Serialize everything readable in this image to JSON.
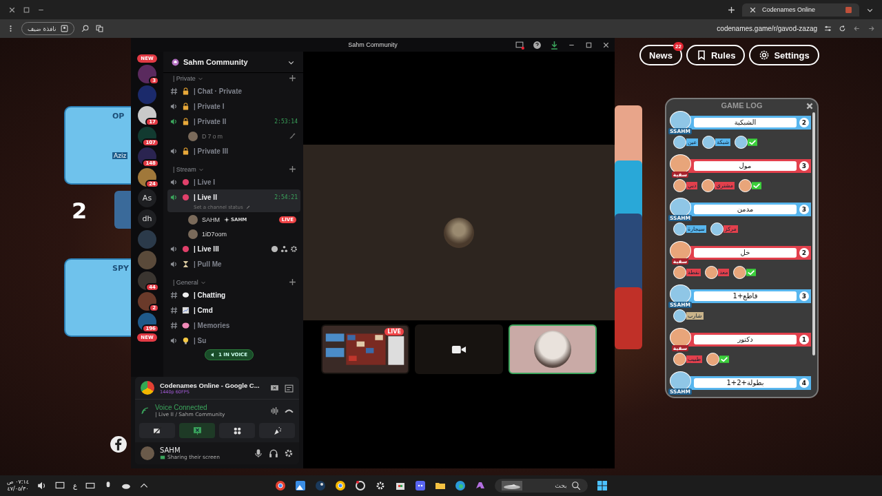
{
  "browser": {
    "tab": {
      "title": "Codenames Online",
      "selected": true
    },
    "guest_button": "نافذة ضيف",
    "url": "codenames.game/r/gavod-zazag"
  },
  "game": {
    "header_buttons": [
      {
        "kind": "settings",
        "label": "Settings"
      },
      {
        "kind": "rules",
        "label": "Rules"
      },
      {
        "kind": "news",
        "label": "News",
        "badge": "22"
      }
    ],
    "left_board": {
      "top_card_title": "OP",
      "player_name": "Aziz",
      "score": "2",
      "bottom_card_title": "SPY"
    }
  },
  "game_log": {
    "title": "GAME LOG",
    "entries": [
      {
        "color": "#58b6ee",
        "player": "SSAHM",
        "clue": "الشبكية",
        "number": "2",
        "guesses": [
          {
            "kind": "check"
          },
          {
            "kind": "word",
            "word": "شبكة",
            "color": "#58b6ee"
          },
          {
            "kind": "word",
            "word": "عين",
            "color": "#58b6ee"
          }
        ]
      },
      {
        "color": "#e2404c",
        "player": "سفية",
        "clue": "مول",
        "number": "3",
        "guesses": [
          {
            "kind": "check"
          },
          {
            "kind": "word",
            "word": "مشتري",
            "color": "#e2404c"
          },
          {
            "kind": "word",
            "word": "دبي",
            "color": "#e2404c"
          }
        ]
      },
      {
        "color": "#58b6ee",
        "player": "SSAHM",
        "clue": "مدمن",
        "number": "3",
        "guesses": [
          {
            "kind": "word",
            "word": "مركز",
            "color": "#e2404c"
          },
          {
            "kind": "word",
            "word": "سيجارة",
            "color": "#58b6ee"
          }
        ]
      },
      {
        "color": "#e2404c",
        "player": "سفية",
        "clue": "خل",
        "number": "2",
        "guesses": [
          {
            "kind": "check"
          },
          {
            "kind": "word",
            "word": "معد",
            "color": "#e2404c"
          },
          {
            "kind": "word",
            "word": "نقطة",
            "color": "#e2404c"
          }
        ]
      },
      {
        "color": "#58b6ee",
        "player": "SSAHM",
        "clue": "قاطع+1",
        "number": "3",
        "guesses": [
          {
            "kind": "word",
            "word": "شارب",
            "color": "#c9b38a"
          }
        ]
      },
      {
        "color": "#e2404c",
        "player": "سفية",
        "clue": "دكتور",
        "number": "1",
        "guesses": [
          {
            "kind": "check"
          },
          {
            "kind": "word",
            "word": "طبيب",
            "color": "#e2404c"
          }
        ]
      },
      {
        "color": "#58b6ee",
        "player": "SSAHM",
        "clue": "بطولة+2+1",
        "number": "4"
      }
    ]
  },
  "discord": {
    "window_title": "Sahm Community",
    "server_name": "Sahm Community",
    "servers": [
      {
        "kind": "new",
        "label": "NEW"
      },
      {
        "kind": "avatar",
        "color": "#5a2a5e",
        "badge": "3"
      },
      {
        "kind": "avatar",
        "color": "#1b2a6b"
      },
      {
        "kind": "avatar",
        "color": "#c9c9c9",
        "badge": "17"
      },
      {
        "kind": "avatar",
        "color": "#123a30",
        "badge": "107"
      },
      {
        "kind": "avatar",
        "color": "#2a2450",
        "badge": "148"
      },
      {
        "kind": "avatar",
        "color": "#a0783a",
        "badge": "24"
      },
      {
        "kind": "text",
        "label": "As"
      },
      {
        "kind": "text",
        "label": "dh"
      },
      {
        "kind": "avatar",
        "color": "#2b3a4a"
      },
      {
        "kind": "avatar",
        "color": "#5a4a3a"
      },
      {
        "kind": "avatar",
        "color": "#3a3530",
        "badge": "44"
      },
      {
        "kind": "avatar",
        "color": "#6a3a2a",
        "badge": "2"
      },
      {
        "kind": "avatar",
        "color": "#1f5a8a",
        "badge": "196"
      },
      {
        "kind": "new",
        "label": "NEW"
      }
    ],
    "categories": [
      {
        "name": "| Private",
        "channels": [
          {
            "kind": "text",
            "name": "| Chat · Private",
            "locked": true,
            "unread": false,
            "selected": false
          },
          {
            "kind": "voice",
            "name": "| Private I",
            "locked": true,
            "active": false,
            "unread": false,
            "selected": false
          },
          {
            "kind": "voice",
            "name": "| Private II",
            "locked": true,
            "active": true,
            "unread": false,
            "selected": false,
            "timer": "2:53:14",
            "members": [
              {
                "name": "D7om",
                "muted": true
              }
            ]
          },
          {
            "kind": "voice",
            "name": "| Private III",
            "locked": true,
            "active": false,
            "unread": false,
            "selected": false
          }
        ]
      },
      {
        "name": "| Stream",
        "channels": [
          {
            "kind": "voice",
            "name": "| Live I",
            "locked": false,
            "active": false,
            "unread": false,
            "selected": false
          },
          {
            "kind": "voice",
            "name": "| Live II",
            "locked": false,
            "active": true,
            "unread": true,
            "selected": true,
            "timer": "2:54:21",
            "status": "Set a channel status",
            "members": [
              {
                "name": "SAHM",
                "tag": "SAHM",
                "live": "LIVE",
                "muted": false
              },
              {
                "name": "1iD7oom",
                "muted": false
              }
            ]
          },
          {
            "kind": "voice",
            "name": "| Live III",
            "locked": false,
            "active": false,
            "unread": true,
            "selected": false,
            "hovered": true
          },
          {
            "kind": "voice",
            "name": "| Pull Me",
            "locked": false,
            "active": false,
            "unread": false,
            "selected": false
          }
        ]
      },
      {
        "name": "| General",
        "channels": [
          {
            "kind": "text",
            "name": "| Chatting",
            "locked": false,
            "unread": true,
            "selected": false
          },
          {
            "kind": "text",
            "name": "| Cmd",
            "locked": false,
            "unread": true,
            "selected": false
          },
          {
            "kind": "text",
            "name": "| Memories",
            "locked": false,
            "unread": false,
            "selected": false
          },
          {
            "kind": "voice",
            "name": "| Su",
            "locked": false,
            "active": false,
            "unread": false,
            "selected": false
          }
        ]
      }
    ],
    "voice_pill": "1 IN VOICE",
    "stream": {
      "title": "Codenames Online - Google C...",
      "quality": "1440p 60FPS"
    },
    "voice": {
      "status": "Voice Connected",
      "channel": "| Live II / Sahm Community"
    },
    "user": {
      "name": "SAHM",
      "status": "Sharing their screen"
    },
    "thumbnails": [
      {
        "kind": "screen",
        "live": "LIVE",
        "selected": false
      },
      {
        "kind": "camera",
        "selected": false
      },
      {
        "kind": "avatar",
        "selected": true
      }
    ]
  },
  "taskbar": {
    "time": "٠٧:١٤ ص",
    "date": "٤٧/٠٥/٣٠",
    "language": "ع",
    "search_placeholder": "بحث"
  }
}
